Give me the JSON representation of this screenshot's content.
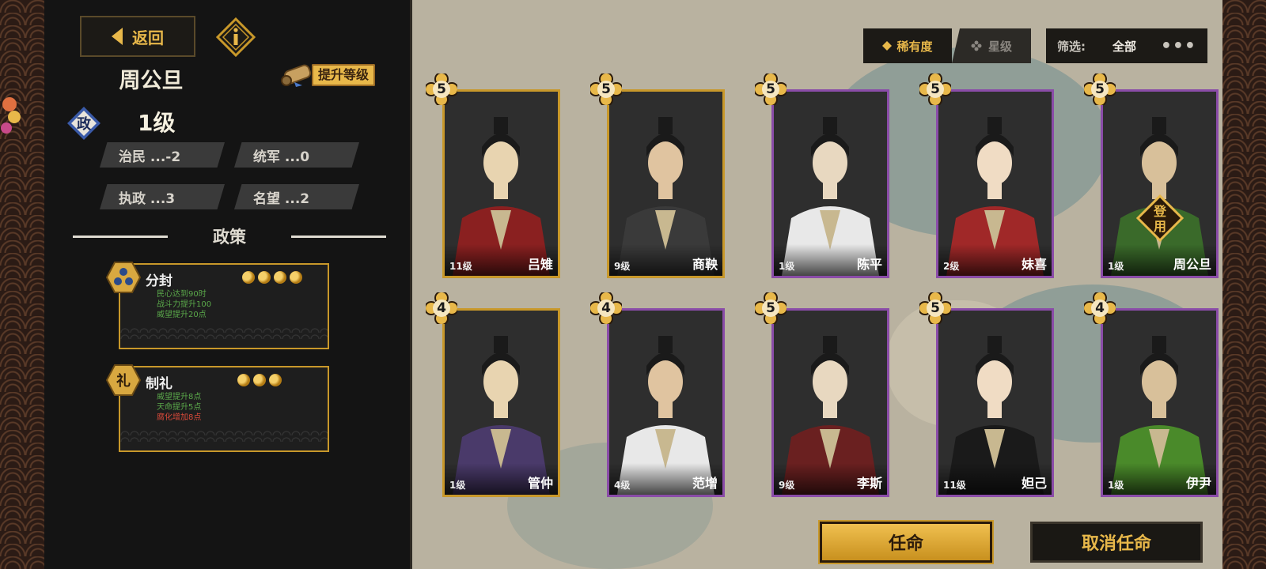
{
  "left_panel": {
    "back_label": "返回",
    "hero_name": "周公旦",
    "upgrade_label": "提升等级",
    "badge_char": "政",
    "level_label": "1级",
    "stats": [
      {
        "label": "治民 ...-2"
      },
      {
        "label": "统军 ...0"
      },
      {
        "label": "执政 ...3"
      },
      {
        "label": "名望 ...2"
      }
    ],
    "policies_title": "政策",
    "policies": [
      {
        "name": "分封",
        "tokens": 4,
        "effects": [
          {
            "text": "民心达到90时",
            "color": "green"
          },
          {
            "text": "战斗力提升100",
            "color": "green"
          },
          {
            "text": "威望提升20点",
            "color": "green"
          }
        ]
      },
      {
        "name": "制礼",
        "icon_char": "礼",
        "tokens": 3,
        "effects": [
          {
            "text": "威望提升8点",
            "color": "green"
          },
          {
            "text": "天命提升5点",
            "color": "green"
          },
          {
            "text": "腐化增加8点",
            "color": "red"
          }
        ]
      }
    ]
  },
  "toolbar": {
    "sort_rarity": "稀有度",
    "sort_star": "星级",
    "filter_label": "筛选:",
    "filter_value": "全部",
    "more": "•••"
  },
  "cards": [
    {
      "stars": "5",
      "level": "11级",
      "name": "吕雉",
      "frame": "gold"
    },
    {
      "stars": "5",
      "level": "9级",
      "name": "商鞅",
      "frame": "gold"
    },
    {
      "stars": "5",
      "level": "1级",
      "name": "陈平",
      "frame": "purple"
    },
    {
      "stars": "5",
      "level": "2级",
      "name": "妹喜",
      "frame": "purple"
    },
    {
      "stars": "5",
      "level": "1级",
      "name": "周公旦",
      "frame": "purple",
      "tag": "登用"
    },
    {
      "stars": "4",
      "level": "1级",
      "name": "管仲",
      "frame": "gold"
    },
    {
      "stars": "4",
      "level": "4级",
      "name": "范增",
      "frame": "purple"
    },
    {
      "stars": "5",
      "level": "9级",
      "name": "李斯",
      "frame": "purple"
    },
    {
      "stars": "5",
      "level": "11级",
      "name": "妲己",
      "frame": "purple"
    },
    {
      "stars": "4",
      "level": "1级",
      "name": "伊尹",
      "frame": "purple"
    }
  ],
  "actions": {
    "appoint": "任命",
    "cancel_appoint": "取消任命"
  },
  "colors": {
    "gold": "#c8982a",
    "purple": "#8a4ca8",
    "accent": "#e8b84a"
  }
}
